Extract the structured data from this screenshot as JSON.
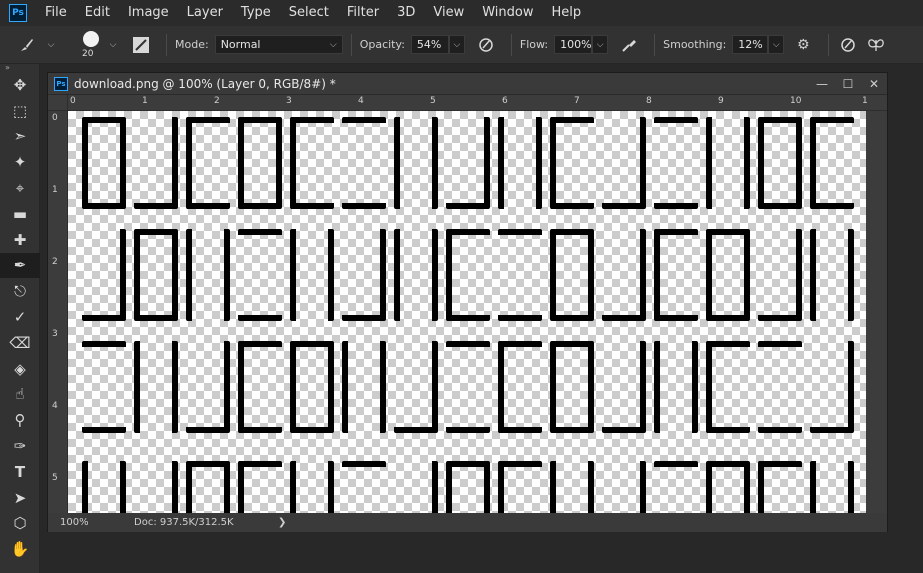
{
  "menu": {
    "items": [
      "File",
      "Edit",
      "Image",
      "Layer",
      "Type",
      "Select",
      "Filter",
      "3D",
      "View",
      "Window",
      "Help"
    ]
  },
  "options": {
    "brush_size": "20",
    "mode_label": "Mode:",
    "mode_value": "Normal",
    "opacity_label": "Opacity:",
    "opacity_value": "54%",
    "flow_label": "Flow:",
    "flow_value": "100%",
    "smoothing_label": "Smoothing:",
    "smoothing_value": "12%"
  },
  "toolbar": {
    "tools": [
      "move-icon",
      "marquee-icon",
      "lasso-icon",
      "magic-wand-icon",
      "crop-icon",
      "ruler-icon",
      "healing-icon",
      "brush-icon",
      "stamp-icon",
      "history-brush-icon",
      "eraser-icon",
      "paint-bucket-icon",
      "smudge-icon",
      "dodge-icon",
      "pen-icon",
      "type-icon",
      "path-select-icon",
      "shape-icon",
      "hand-icon"
    ],
    "active_tool": "brush-icon"
  },
  "document": {
    "title": "download.png @ 100% (Layer 0, RGB/8#) *",
    "ruler_top": [
      "0",
      "1",
      "2",
      "3",
      "4",
      "5",
      "6",
      "7",
      "8",
      "9",
      "10",
      "1"
    ],
    "ruler_left": [
      "0",
      "1",
      "2",
      "3",
      "4",
      "5"
    ],
    "status_zoom": "100%",
    "status_doc": "Doc: 937.5K/312.5K"
  },
  "colors": {
    "accent": "#31a8ff",
    "ui_bg": "#323232",
    "canvas_ink": "#000000"
  }
}
